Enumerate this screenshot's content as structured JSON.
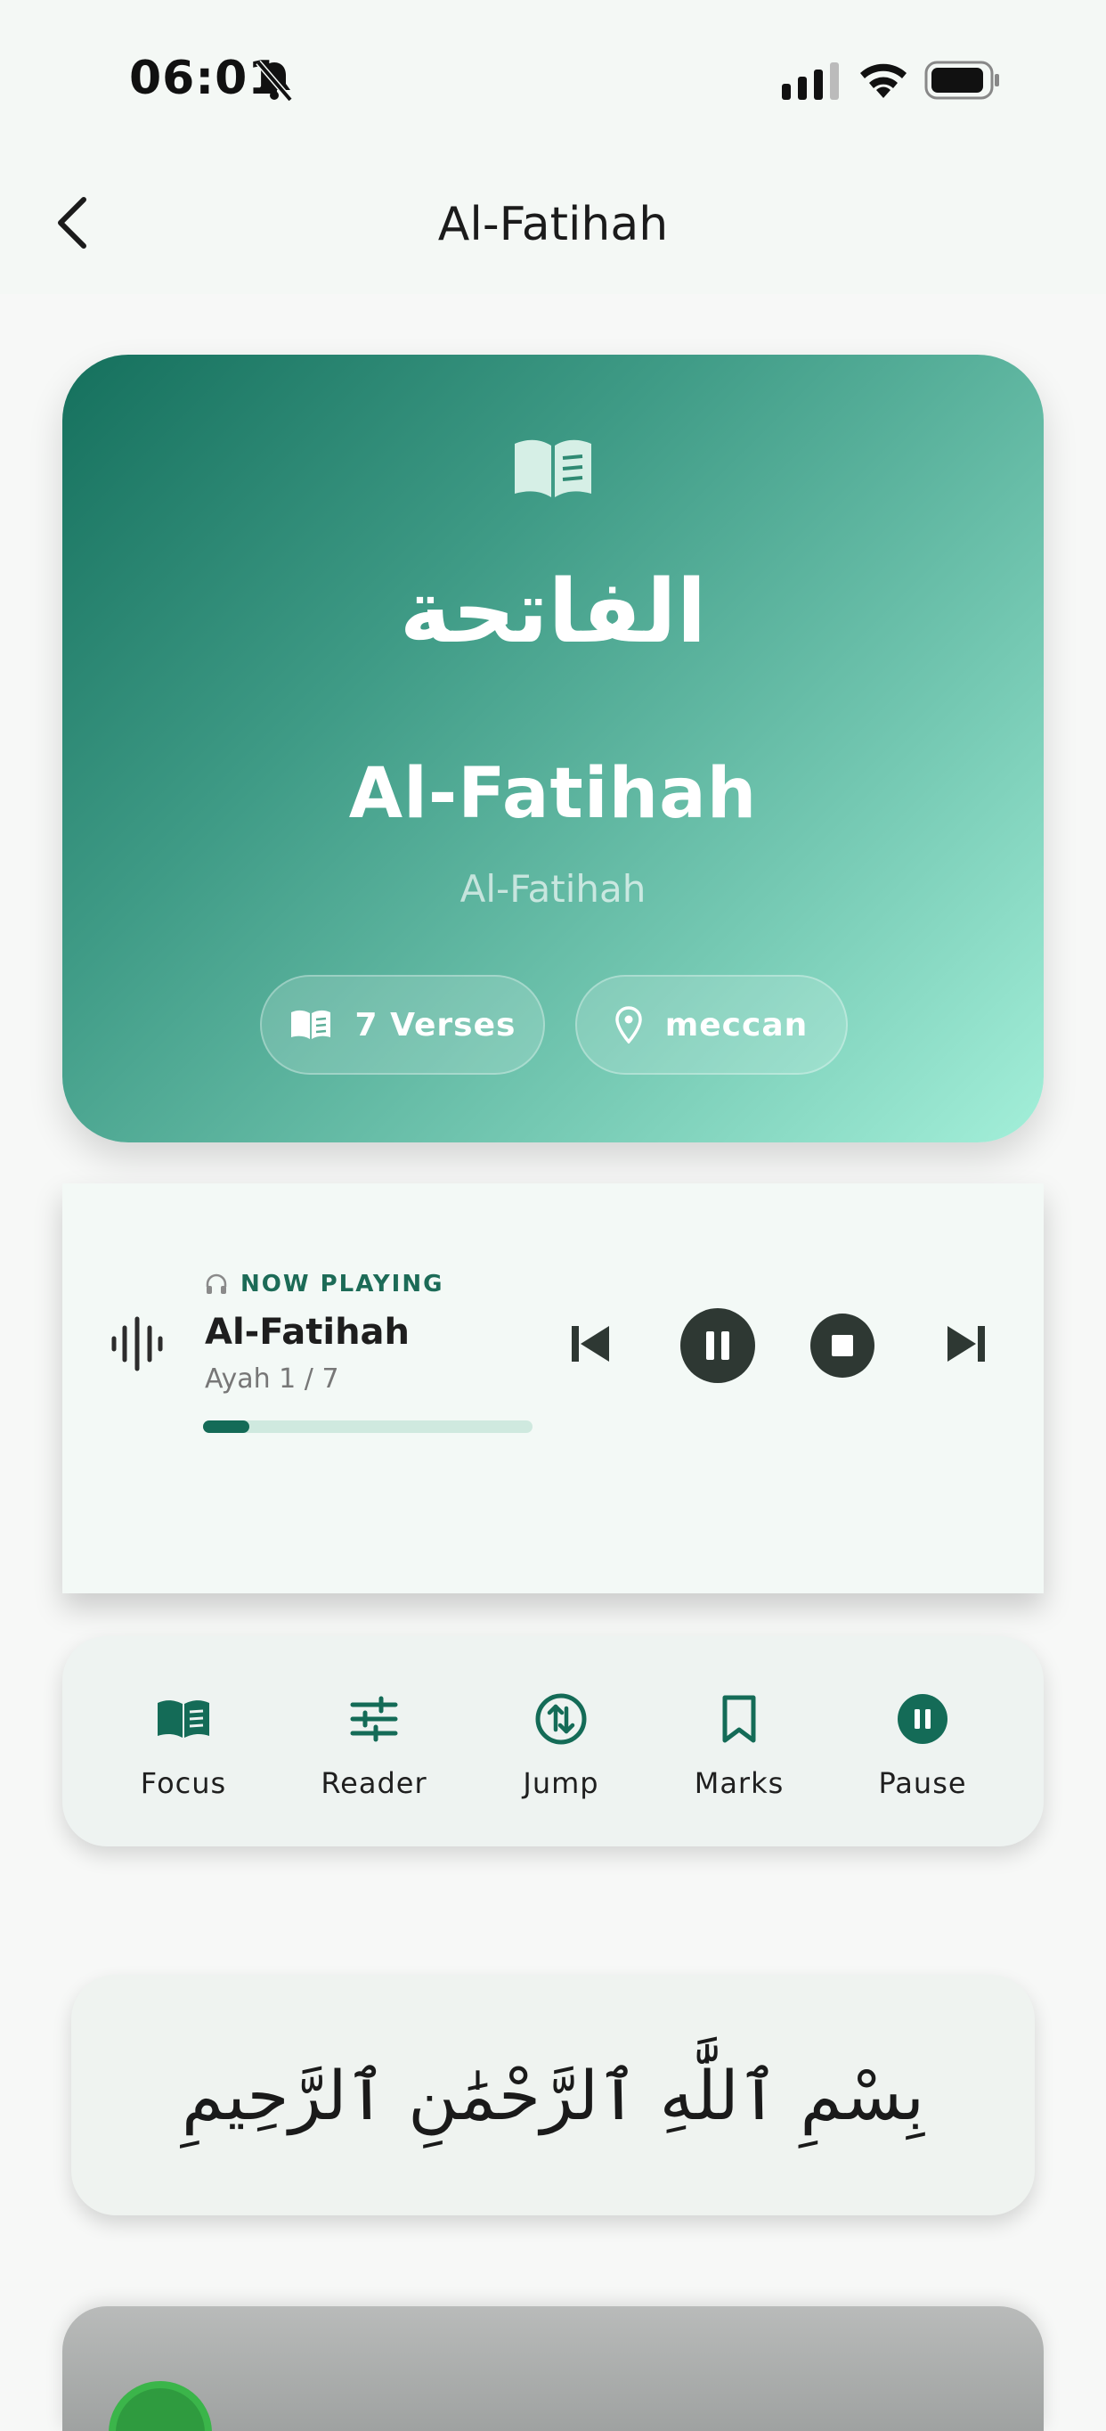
{
  "status": {
    "time": "06:01"
  },
  "header": {
    "title": "Al-Fatihah"
  },
  "hero": {
    "arabic_name": "الفاتحة",
    "english_name": "Al-Fatihah",
    "transliteration": "Al-Fatihah",
    "verses_chip": "7 Verses",
    "revelation_chip": "meccan"
  },
  "player": {
    "label": "NOW PLAYING",
    "title": "Al-Fatihah",
    "ayah": "Ayah 1 / 7",
    "progress": 0.14
  },
  "actions": [
    {
      "label": "Focus",
      "icon": "open-book-icon"
    },
    {
      "label": "Reader",
      "icon": "sliders-icon"
    },
    {
      "label": "Jump",
      "icon": "swap-vertical-icon"
    },
    {
      "label": "Marks",
      "icon": "bookmark-icon"
    },
    {
      "label": "Pause",
      "icon": "pause-circle-icon"
    }
  ],
  "bismillah": "بِسْمِ ٱللَّٰهِ ٱلرَّحْمَٰنِ ٱلرَّحِيمِ",
  "colors": {
    "accent": "#146b57",
    "hero_start": "#15705d",
    "hero_end": "#a3efd9",
    "player_btn": "#2e3833"
  }
}
